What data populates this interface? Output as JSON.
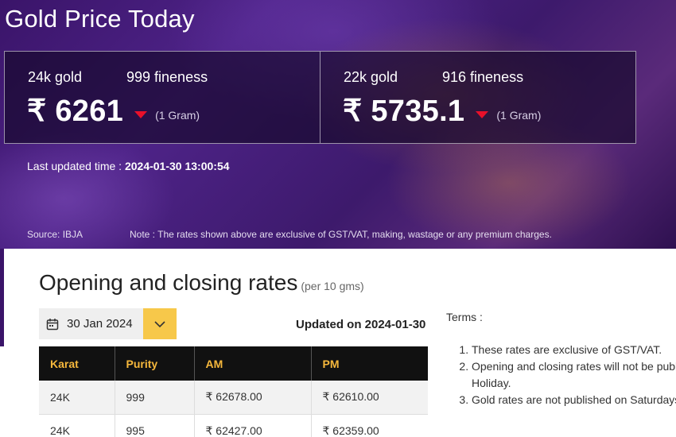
{
  "hero": {
    "title": "Gold Price Today",
    "cards": [
      {
        "karat": "24k gold",
        "fineness": "999 fineness",
        "price": "₹ 6261",
        "trend": "down",
        "unit": "(1 Gram)"
      },
      {
        "karat": "22k gold",
        "fineness": "916 fineness",
        "price": "₹ 5735.1",
        "trend": "down",
        "unit": "(1 Gram)"
      }
    ],
    "last_updated_label": "Last updated time : ",
    "last_updated_value": "2024-01-30 13:00:54",
    "source": "Source: IBJA",
    "note": "Note : The rates shown above are exclusive of GST/VAT, making, wastage or any premium charges."
  },
  "rates": {
    "title": "Opening and closing rates",
    "subtitle": "(per 10 gms)",
    "date_value": "30 Jan 2024",
    "updated_on": "Updated on 2024-01-30",
    "headers": [
      "Karat",
      "Purity",
      "AM",
      "PM"
    ],
    "rows": [
      [
        "24K",
        "999",
        "₹ 62678.00",
        "₹ 62610.00"
      ],
      [
        "24K",
        "995",
        "₹ 62427.00",
        "₹ 62359.00"
      ]
    ]
  },
  "terms": {
    "heading": "Terms :",
    "items": [
      "These rates are exclusive of GST/VAT.",
      "Opening and closing rates will not be published on Holiday.",
      "Gold rates are not published on Saturdays and Sundays."
    ]
  },
  "colors": {
    "accent": "#f7c84a",
    "header_text": "#f6b83c",
    "trend_down": "#e8102a",
    "hero_bg": "#3a1469"
  },
  "icons": {
    "calendar": "calendar-icon",
    "chevron": "chevron-down-icon",
    "trend": "trend-down-icon"
  }
}
